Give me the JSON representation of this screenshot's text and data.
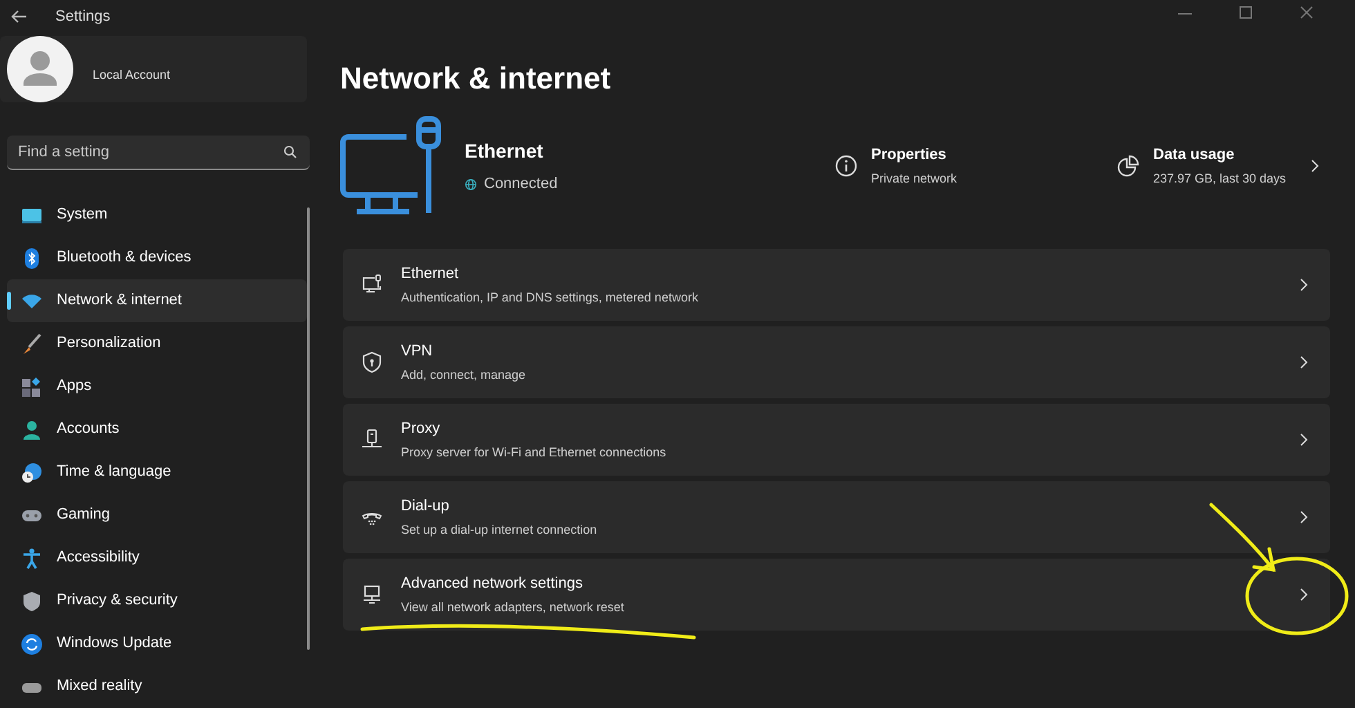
{
  "window": {
    "title": "Settings"
  },
  "account": {
    "name": "Local Account"
  },
  "search": {
    "placeholder": "Find a setting"
  },
  "sidebar": {
    "items": [
      {
        "label": "System",
        "kind": "system",
        "selected": false
      },
      {
        "label": "Bluetooth & devices",
        "kind": "bluetooth",
        "selected": false
      },
      {
        "label": "Network & internet",
        "kind": "wifi",
        "selected": true
      },
      {
        "label": "Personalization",
        "kind": "brush",
        "selected": false
      },
      {
        "label": "Apps",
        "kind": "apps",
        "selected": false
      },
      {
        "label": "Accounts",
        "kind": "person",
        "selected": false
      },
      {
        "label": "Time & language",
        "kind": "globe",
        "selected": false
      },
      {
        "label": "Gaming",
        "kind": "gamepad",
        "selected": false
      },
      {
        "label": "Accessibility",
        "kind": "accessibility",
        "selected": false
      },
      {
        "label": "Privacy & security",
        "kind": "shield",
        "selected": false
      },
      {
        "label": "Windows Update",
        "kind": "update",
        "selected": false
      },
      {
        "label": "Mixed reality",
        "kind": "headset",
        "selected": false
      }
    ]
  },
  "page": {
    "title": "Network & internet"
  },
  "connection": {
    "name": "Ethernet",
    "status": "Connected"
  },
  "properties": {
    "title": "Properties",
    "subtitle": "Private network"
  },
  "data_usage": {
    "title": "Data usage",
    "subtitle": "237.97 GB, last 30 days"
  },
  "settings": [
    {
      "kind": "ethernet",
      "title": "Ethernet",
      "subtitle": "Authentication, IP and DNS settings, metered network"
    },
    {
      "kind": "vpn",
      "title": "VPN",
      "subtitle": "Add, connect, manage"
    },
    {
      "kind": "proxy",
      "title": "Proxy",
      "subtitle": "Proxy server for Wi-Fi and Ethernet connections"
    },
    {
      "kind": "dialup",
      "title": "Dial-up",
      "subtitle": "Set up a dial-up internet connection"
    },
    {
      "kind": "advanced",
      "title": "Advanced network settings",
      "subtitle": "View all network adapters, network reset"
    }
  ]
}
